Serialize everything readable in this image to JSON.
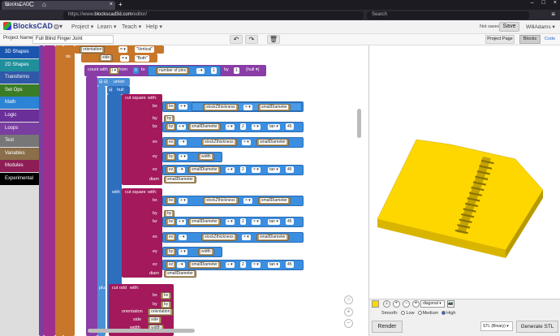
{
  "browser": {
    "tab_title": "BlocksCAD",
    "url_prefix": "https://www.",
    "url_host": "blockscad3d.com",
    "url_path": "/editor/",
    "search_placeholder": "Search",
    "tab_close": "×",
    "new_tab": "+",
    "back": "←",
    "forward": "→",
    "reload": "C",
    "home": "⌂",
    "menu": "≡",
    "win_min": "–",
    "win_max": "□",
    "win_close": "×"
  },
  "header": {
    "logo": "BlocksCAD",
    "globe": "◍▾",
    "menus": [
      "Project ▾",
      "Learn ▾",
      "Teach ▾",
      "Help ▾"
    ],
    "status": "Not saved",
    "save_label": "Save",
    "user": "WillAdams ▾"
  },
  "project": {
    "label": "Project Name",
    "name": "Full Blind Finger Joint",
    "undo": "↶",
    "redo": "↷",
    "trash": "🗑",
    "project_page": "Project Page",
    "blocks": "Blocks",
    "code": "Code"
  },
  "categories": [
    {
      "label": "3D Shapes",
      "color": "#1a56b0"
    },
    {
      "label": "2D Shapes",
      "color": "#1f8f9c"
    },
    {
      "label": "Transforms",
      "color": "#3058a8"
    },
    {
      "label": "Set Ops",
      "color": "#3a7c25"
    },
    {
      "label": "Math",
      "color": "#2b84d6"
    },
    {
      "label": "Logic",
      "color": "#6a2f99"
    },
    {
      "label": "Loops",
      "color": "#7a3ea0"
    },
    {
      "label": "Text",
      "color": "#777777"
    },
    {
      "label": "Variables",
      "color": "#8a6f4a"
    },
    {
      "label": "Modules",
      "color": "#8e1d55"
    },
    {
      "label": "Experimental",
      "color": "#000000"
    }
  ],
  "blocks": {
    "orientation": "orientation",
    "eq": "= ▾",
    "vertical": "\"Vertical\"",
    "do": "do",
    "if": "if",
    "side": "side",
    "both": "\"Both\"",
    "count_with": "count with",
    "i": "i ▾",
    "from": "from",
    "zero": "0",
    "to": "to",
    "num_pins": "number of pins",
    "minus": "- ▾",
    "one": "1",
    "by": "by",
    "hull_lbl": "(hull ▾)",
    "union": "union",
    "hull": "hull",
    "cut_square": "cut square",
    "with": "with:",
    "bx": "bx",
    "by_v": "by",
    "bz": "bz",
    "ex": "ex",
    "ey": "ey",
    "ez": "ez",
    "diam": "diam",
    "plus": "+ ▾",
    "times": "× ▾",
    "div": "÷ ▾",
    "stock": "stockZthickness",
    "small": "smallDiameter",
    "two": "2",
    "tan": "tan ▾",
    "fortyfive": "45",
    "width": "width",
    "with2": "with",
    "plus_lbl": "plus",
    "cut_odd": "cut odd",
    "bx2": "bx",
    "by2": "by",
    "orientation2": "orientation",
    "side2": "side",
    "width2": "width"
  },
  "zoom": {
    "plus": "+",
    "minus": "−",
    "reset": "○"
  },
  "viewer": {
    "zoom_in": "+",
    "zoom_out": "−",
    "reset": "⌖",
    "view": "diagonal ▾",
    "camera": "📷",
    "smooth_label": "Smooth:",
    "smooth_options": [
      "Low",
      "Medium",
      "High"
    ],
    "smooth_selected": "High",
    "render": "Render",
    "format": "STL (Binary) ▾",
    "generate": "Generate STL",
    "model_color": "#ffd700"
  }
}
